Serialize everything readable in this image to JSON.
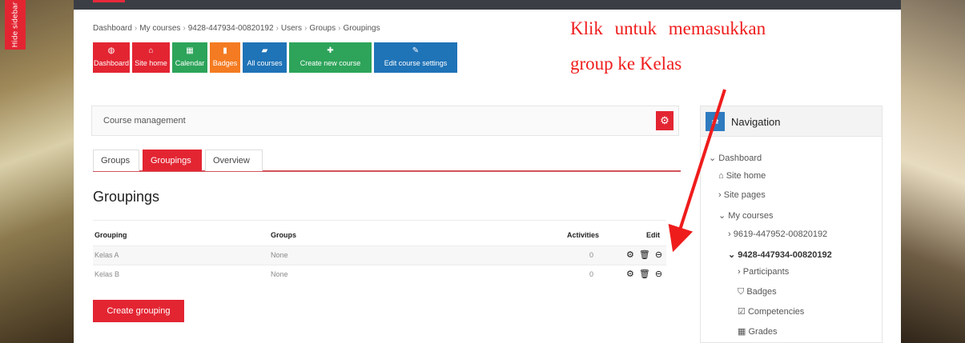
{
  "sidebar_toggle": {
    "label": "Hide sidebar"
  },
  "breadcrumb": [
    "Dashboard",
    "My courses",
    "9428-447934-00820192",
    "Users",
    "Groups",
    "Groupings"
  ],
  "quicknav": [
    {
      "label": "Dashboard",
      "icon": "dashboard-icon",
      "color": "#e32532"
    },
    {
      "label": "Site home",
      "icon": "home-icon",
      "color": "#e32532"
    },
    {
      "label": "Calendar",
      "icon": "calendar-icon",
      "color": "#2da45a"
    },
    {
      "label": "Badges",
      "icon": "bookmark-icon",
      "color": "#f47b21"
    },
    {
      "label": "All courses",
      "icon": "book-icon",
      "color": "#1f73b7"
    },
    {
      "label": "Create new course",
      "icon": "plus-icon",
      "color": "#2da45a"
    },
    {
      "label": "Edit course settings",
      "icon": "edit-icon",
      "color": "#1f73b7"
    }
  ],
  "annotation": {
    "line1": "Klik untuk memasukkan",
    "line2": "group ke Kelas",
    "color": "#ef1c1c"
  },
  "course_management": {
    "label": "Course management"
  },
  "tabs": [
    {
      "label": "Groups",
      "active": false
    },
    {
      "label": "Groupings",
      "active": true
    },
    {
      "label": "Overview",
      "active": false
    }
  ],
  "page_title": "Groupings",
  "table": {
    "headers": {
      "grouping": "Grouping",
      "groups": "Groups",
      "activities": "Activities",
      "edit": "Edit"
    },
    "rows": [
      {
        "grouping": "Kelas A",
        "groups": "None",
        "activities": "0"
      },
      {
        "grouping": "Kelas B",
        "groups": "None",
        "activities": "0"
      }
    ]
  },
  "create_button": "Create grouping",
  "navigation": {
    "title": "Navigation",
    "items": [
      {
        "label": "Dashboard",
        "prefix": "⌄",
        "bold": false
      },
      {
        "label": "Site home",
        "prefix": "🏠",
        "bold": false
      },
      {
        "label": "Site pages",
        "prefix": "›",
        "bold": false
      },
      {
        "label": "My courses",
        "prefix": "⌄",
        "bold": false
      },
      {
        "label": "9619-447952-00820192",
        "prefix": "›",
        "bold": false
      },
      {
        "label": "9428-447934-00820192",
        "prefix": "⌄",
        "bold": true
      },
      {
        "label": "Participants",
        "prefix": "›",
        "bold": false
      },
      {
        "label": "Badges",
        "prefix": "⛉",
        "bold": false
      },
      {
        "label": "Competencies",
        "prefix": "☑",
        "bold": false
      },
      {
        "label": "Grades",
        "prefix": "▦",
        "bold": false
      }
    ]
  },
  "theme": {
    "primary": "#e32532",
    "accent_blue": "#1f73b7",
    "accent_green": "#2da45a",
    "accent_orange": "#f47b21"
  }
}
